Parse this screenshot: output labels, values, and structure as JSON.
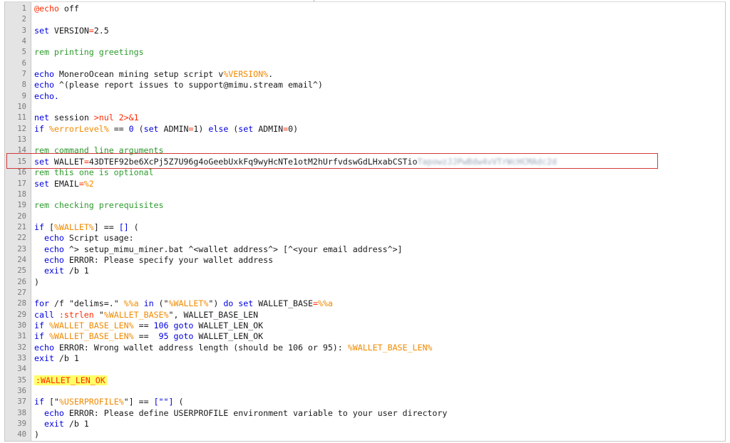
{
  "editor": {
    "lines": [
      {
        "n": "1",
        "t": [
          {
            "s": "@echo",
            "c": "op"
          },
          {
            "s": " off"
          }
        ]
      },
      {
        "n": "2",
        "t": []
      },
      {
        "n": "3",
        "t": [
          {
            "s": "set",
            "c": "kw"
          },
          {
            "s": " VERSION"
          },
          {
            "s": "=",
            "c": "op"
          },
          {
            "s": "2.5"
          }
        ]
      },
      {
        "n": "4",
        "t": []
      },
      {
        "n": "5",
        "t": [
          {
            "s": "rem printing greetings",
            "c": "cm"
          }
        ]
      },
      {
        "n": "6",
        "t": []
      },
      {
        "n": "7",
        "t": [
          {
            "s": "echo",
            "c": "kw"
          },
          {
            "s": " MoneroOcean mining setup script v"
          },
          {
            "s": "%VERSION%",
            "c": "var"
          },
          {
            "s": "."
          }
        ]
      },
      {
        "n": "8",
        "t": [
          {
            "s": "echo",
            "c": "kw"
          },
          {
            "s": " ^(please report issues to support@mimu.stream email^)"
          }
        ]
      },
      {
        "n": "9",
        "t": [
          {
            "s": "echo.",
            "c": "kw"
          }
        ]
      },
      {
        "n": "10",
        "t": []
      },
      {
        "n": "11",
        "t": [
          {
            "s": "net",
            "c": "kw"
          },
          {
            "s": " session "
          },
          {
            "s": ">nul 2>&1",
            "c": "op"
          }
        ]
      },
      {
        "n": "12",
        "t": [
          {
            "s": "if",
            "c": "kw"
          },
          {
            "s": " "
          },
          {
            "s": "%errorLevel%",
            "c": "var"
          },
          {
            "s": " == "
          },
          {
            "s": "0",
            "c": "kw"
          },
          {
            "s": " ("
          },
          {
            "s": "set",
            "c": "kw"
          },
          {
            "s": " ADMIN"
          },
          {
            "s": "=",
            "c": "op"
          },
          {
            "s": "1) "
          },
          {
            "s": "else",
            "c": "kw"
          },
          {
            "s": " ("
          },
          {
            "s": "set",
            "c": "kw"
          },
          {
            "s": " ADMIN"
          },
          {
            "s": "=",
            "c": "op"
          },
          {
            "s": "0)"
          }
        ]
      },
      {
        "n": "13",
        "t": []
      },
      {
        "n": "14",
        "t": [
          {
            "s": "rem command line arguments",
            "c": "cm"
          }
        ]
      },
      {
        "n": "15",
        "t": [
          {
            "s": "set",
            "c": "kw"
          },
          {
            "s": " WALLET"
          },
          {
            "s": "=",
            "c": "op"
          },
          {
            "s": "43DTEF92be6XcPj5Z7U96g4oGeebUxkFq9wyHcNTe1otM2hUrfvdswGdLHxabCSTio"
          },
          {
            "s": "TapowzJJPwBdw4vVTrWcHCMAdc2d",
            "c": "blur"
          }
        ]
      },
      {
        "n": "16",
        "t": [
          {
            "s": "rem this one is optional",
            "c": "cm"
          }
        ]
      },
      {
        "n": "17",
        "t": [
          {
            "s": "set",
            "c": "kw"
          },
          {
            "s": " EMAIL"
          },
          {
            "s": "=",
            "c": "op"
          },
          {
            "s": "%2",
            "c": "var"
          }
        ]
      },
      {
        "n": "18",
        "t": []
      },
      {
        "n": "19",
        "t": [
          {
            "s": "rem checking prerequisites",
            "c": "cm"
          }
        ]
      },
      {
        "n": "20",
        "t": []
      },
      {
        "n": "21",
        "t": [
          {
            "s": "if",
            "c": "kw"
          },
          {
            "s": " ["
          },
          {
            "s": "%WALLET%",
            "c": "var"
          },
          {
            "s": "] == "
          },
          {
            "s": "[]",
            "c": "kw"
          },
          {
            "s": " ("
          }
        ]
      },
      {
        "n": "22",
        "t": [
          {
            "s": "  "
          },
          {
            "s": "echo",
            "c": "kw"
          },
          {
            "s": " Script usage:"
          }
        ]
      },
      {
        "n": "23",
        "t": [
          {
            "s": "  "
          },
          {
            "s": "echo",
            "c": "kw"
          },
          {
            "s": " ^> setup_mimu_miner.bat ^<wallet address^> [^<your email address^>]"
          }
        ]
      },
      {
        "n": "24",
        "t": [
          {
            "s": "  "
          },
          {
            "s": "echo",
            "c": "kw"
          },
          {
            "s": " ERROR: Please specify your wallet address"
          }
        ]
      },
      {
        "n": "25",
        "t": [
          {
            "s": "  "
          },
          {
            "s": "exit",
            "c": "kw"
          },
          {
            "s": " /b 1"
          }
        ]
      },
      {
        "n": "26",
        "t": [
          {
            "s": ")"
          }
        ]
      },
      {
        "n": "27",
        "t": []
      },
      {
        "n": "28",
        "t": [
          {
            "s": "for",
            "c": "kw"
          },
          {
            "s": " /f \"delims=.\" "
          },
          {
            "s": "%%a",
            "c": "var"
          },
          {
            "s": " "
          },
          {
            "s": "in",
            "c": "kw"
          },
          {
            "s": " (\""
          },
          {
            "s": "%WALLET%",
            "c": "var"
          },
          {
            "s": "\") "
          },
          {
            "s": "do",
            "c": "kw"
          },
          {
            "s": " "
          },
          {
            "s": "set",
            "c": "kw"
          },
          {
            "s": " WALLET_BASE"
          },
          {
            "s": "=",
            "c": "op"
          },
          {
            "s": "%%a",
            "c": "var"
          }
        ]
      },
      {
        "n": "29",
        "t": [
          {
            "s": "call",
            "c": "kw"
          },
          {
            "s": " "
          },
          {
            "s": ":strlen",
            "c": "op"
          },
          {
            "s": " \""
          },
          {
            "s": "%WALLET_BASE%",
            "c": "var"
          },
          {
            "s": "\", WALLET_BASE_LEN"
          }
        ]
      },
      {
        "n": "30",
        "t": [
          {
            "s": "if",
            "c": "kw"
          },
          {
            "s": " "
          },
          {
            "s": "%WALLET_BASE_LEN%",
            "c": "var"
          },
          {
            "s": " == "
          },
          {
            "s": "106",
            "c": "kw"
          },
          {
            "s": " "
          },
          {
            "s": "goto",
            "c": "kw"
          },
          {
            "s": " WALLET_LEN_OK"
          }
        ]
      },
      {
        "n": "31",
        "t": [
          {
            "s": "if",
            "c": "kw"
          },
          {
            "s": " "
          },
          {
            "s": "%WALLET_BASE_LEN%",
            "c": "var"
          },
          {
            "s": " ==  "
          },
          {
            "s": "95",
            "c": "kw"
          },
          {
            "s": " "
          },
          {
            "s": "goto",
            "c": "kw"
          },
          {
            "s": " WALLET_LEN_OK"
          }
        ]
      },
      {
        "n": "32",
        "t": [
          {
            "s": "echo",
            "c": "kw"
          },
          {
            "s": " ERROR: Wrong wallet address length (should be 106 or 95): "
          },
          {
            "s": "%WALLET_BASE_LEN%",
            "c": "var"
          }
        ]
      },
      {
        "n": "33",
        "t": [
          {
            "s": "exit",
            "c": "kw"
          },
          {
            "s": " /b 1"
          }
        ]
      },
      {
        "n": "34",
        "t": []
      },
      {
        "n": "35",
        "t": [
          {
            "s": ":WALLET_LEN_OK",
            "c": "lbl"
          }
        ]
      },
      {
        "n": "36",
        "t": []
      },
      {
        "n": "37",
        "t": [
          {
            "s": "if",
            "c": "kw"
          },
          {
            "s": " [\""
          },
          {
            "s": "%USERPROFILE%",
            "c": "var"
          },
          {
            "s": "\"] == "
          },
          {
            "s": "[\"\"]",
            "c": "kw"
          },
          {
            "s": " ("
          }
        ]
      },
      {
        "n": "38",
        "t": [
          {
            "s": "  "
          },
          {
            "s": "echo",
            "c": "kw"
          },
          {
            "s": " ERROR: Please define USERPROFILE environment variable to your user directory"
          }
        ]
      },
      {
        "n": "39",
        "t": [
          {
            "s": "  "
          },
          {
            "s": "exit",
            "c": "kw"
          },
          {
            "s": " /b 1"
          }
        ]
      },
      {
        "n": "40",
        "t": [
          {
            "s": ")"
          }
        ]
      }
    ]
  }
}
